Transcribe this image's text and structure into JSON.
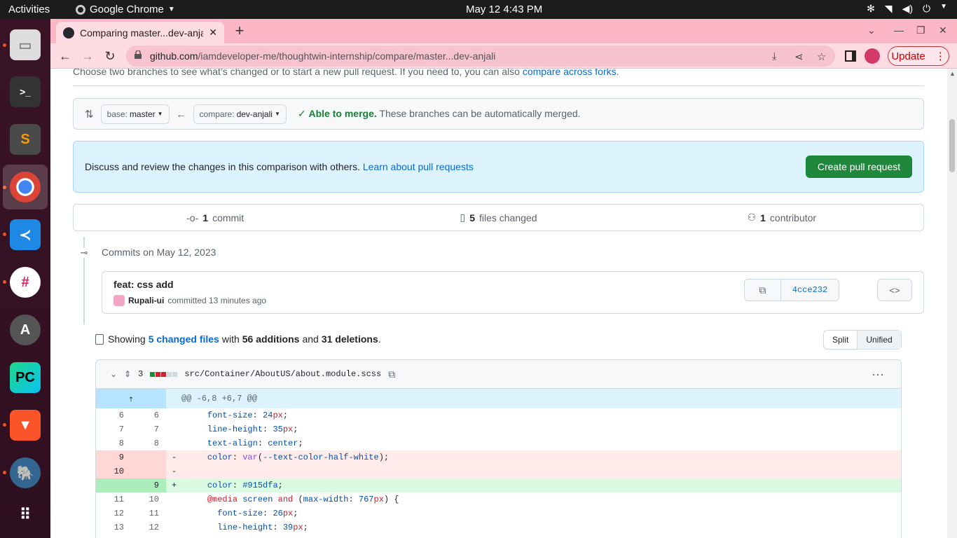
{
  "system": {
    "activities": "Activities",
    "app_name": "Google Chrome",
    "clock": "May 12  4:43 PM"
  },
  "browser": {
    "tab_title": "Comparing master...dev-anjali",
    "url_host": "github.com",
    "url_path": "/iamdeveloper-me/thoughtwin-internship/compare/master...dev-anjali",
    "update_label": "Update"
  },
  "page": {
    "intro_text": "Choose two branches to see what’s changed or to start a new pull request. If you need to, you can also ",
    "intro_link": "compare across forks",
    "intro_end": ".",
    "base_prefix": "base: ",
    "base_value": "master",
    "compare_prefix": "compare: ",
    "compare_value": "dev-anjali",
    "merge_status": "Able to merge.",
    "merge_desc": " These branches can be automatically merged.",
    "flash_text": "Discuss and review the changes in this comparison with others. ",
    "flash_link": "Learn about pull requests",
    "create_pr": "Create pull request",
    "summary": {
      "commits_num": "1",
      "commits_label": "commit",
      "files_num": "5",
      "files_label": "files changed",
      "contrib_num": "1",
      "contrib_label": "contributor"
    },
    "commits_on": "Commits on May 12, 2023",
    "commit": {
      "message": "feat: css add",
      "author": "Rupali-ui",
      "time": "committed 13 minutes ago",
      "sha": "4cce232"
    },
    "showing": {
      "prefix": "Showing",
      "files_link": "5 changed files",
      "with": "with",
      "additions": "56 additions",
      "and": "and",
      "deletions": "31 deletions",
      "end": "."
    },
    "view_split": "Split",
    "view_unified": "Unified",
    "diff": {
      "count": "3",
      "filename": "src/Container/AboutUS/about.module.scss",
      "hunk": "@@ -6,8 +6,7 @@"
    }
  }
}
